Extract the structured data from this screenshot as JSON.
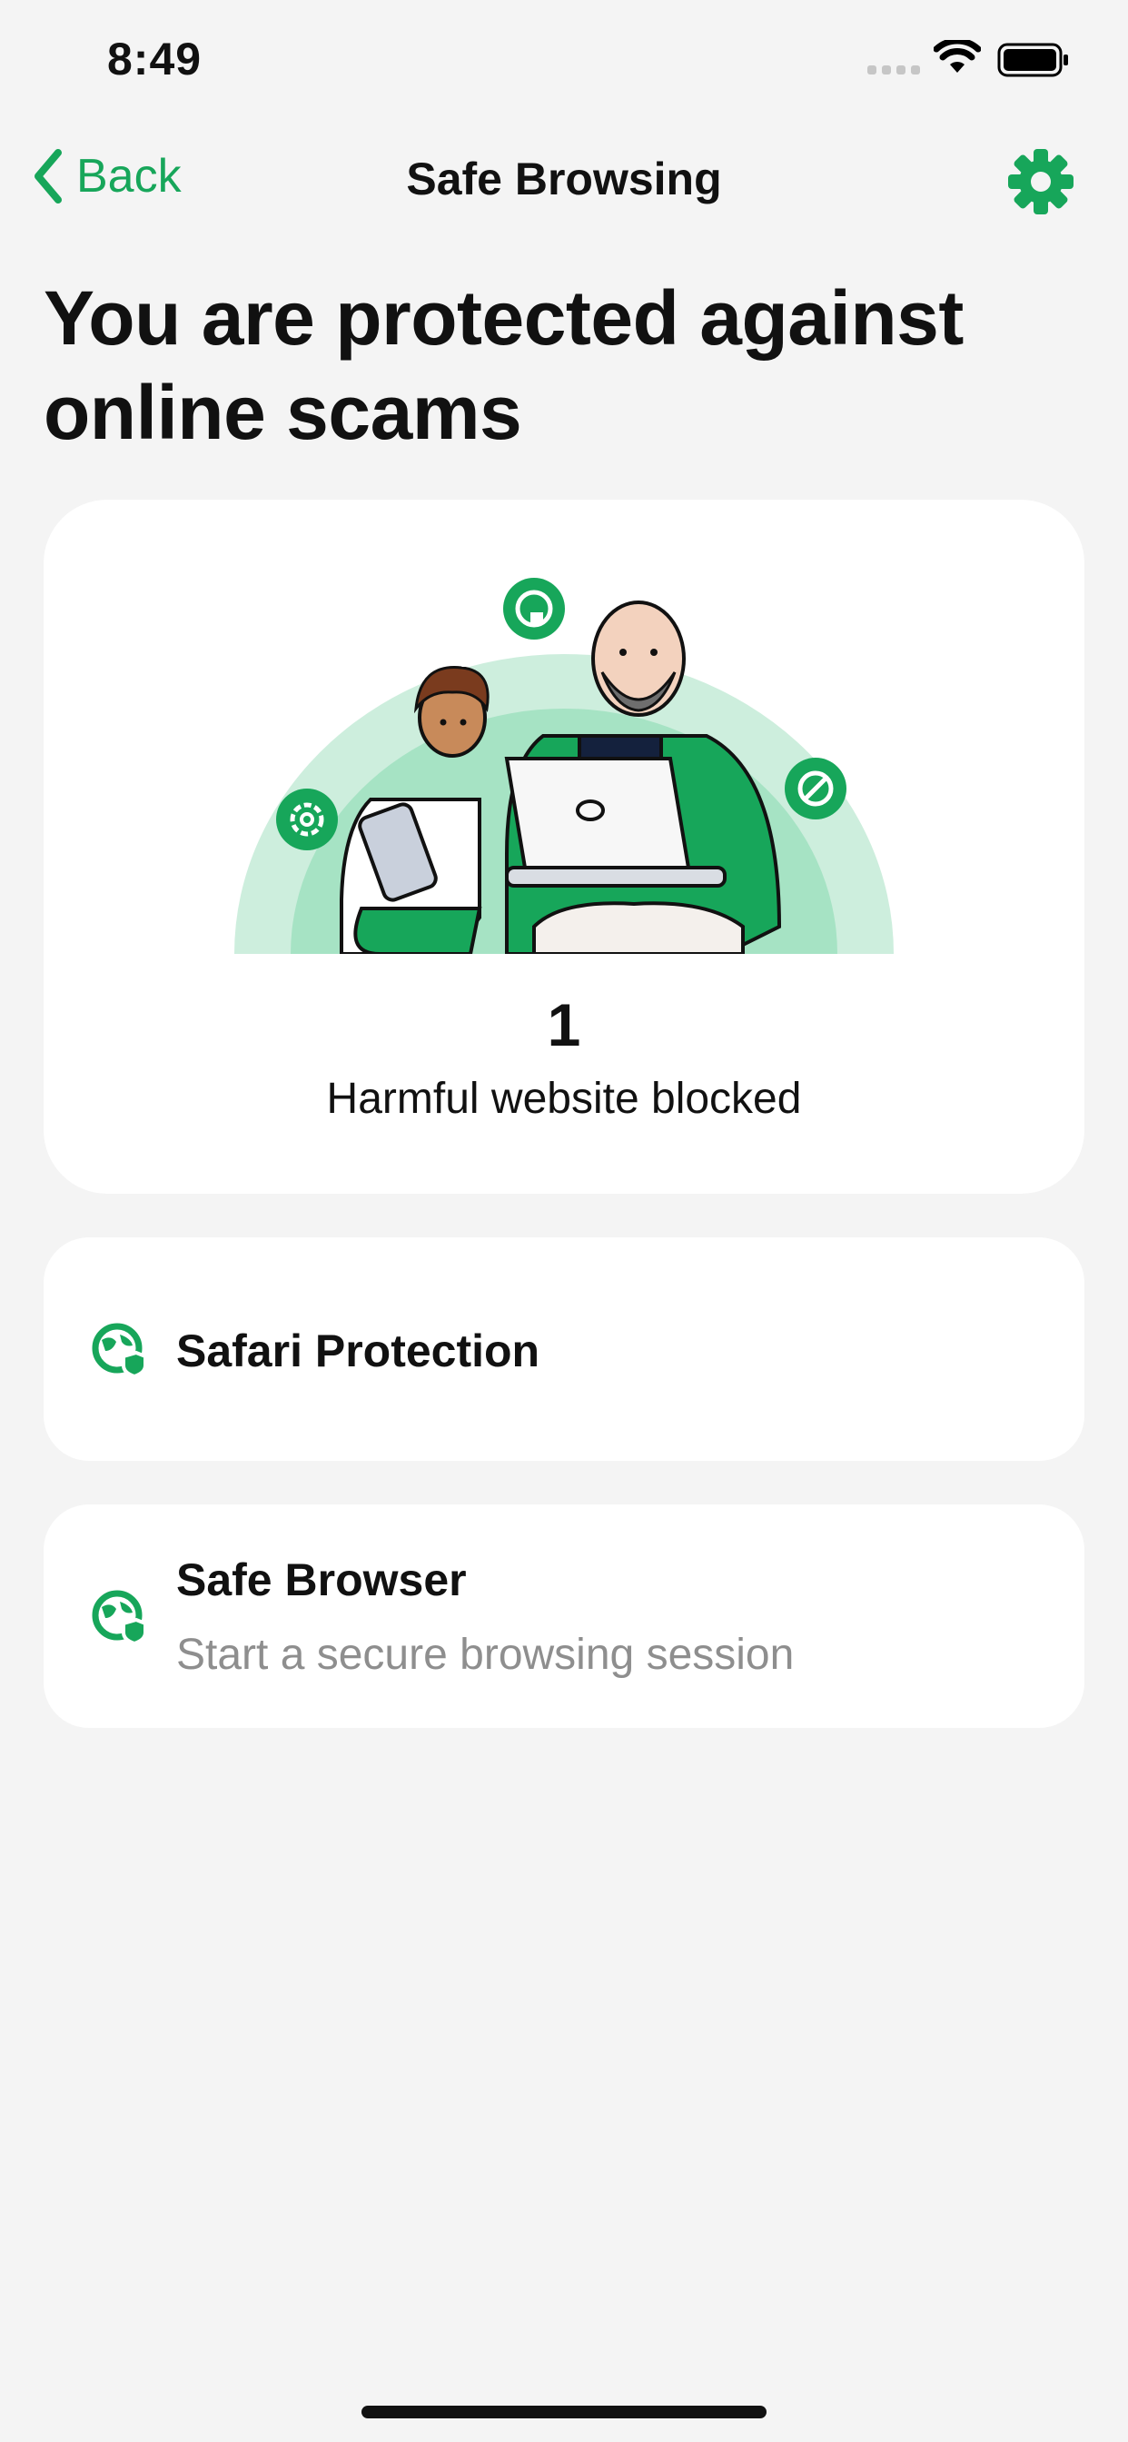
{
  "status_bar": {
    "time": "8:49",
    "icons": [
      "cellular-signal-icon",
      "wifi-icon",
      "battery-icon"
    ]
  },
  "nav": {
    "back_label": "Back",
    "title": "Safe Browsing",
    "settings_icon": "gear-icon"
  },
  "headline": "You are protected against online scams",
  "summary": {
    "blocked_count": "1",
    "blocked_label": "Harmful website blocked"
  },
  "items": [
    {
      "title": "Safari Protection",
      "icon": "globe-shield-icon"
    },
    {
      "title": "Safe Browser",
      "subtitle": "Start a secure browsing session",
      "icon": "globe-shield-icon"
    }
  ],
  "colors": {
    "accent": "#17a65a",
    "background": "#f4f4f4",
    "card": "#ffffff",
    "secondary_text": "#8e8e8e",
    "illustration_light": "#cdeedd",
    "illustration_mid": "#a6e3c4"
  }
}
